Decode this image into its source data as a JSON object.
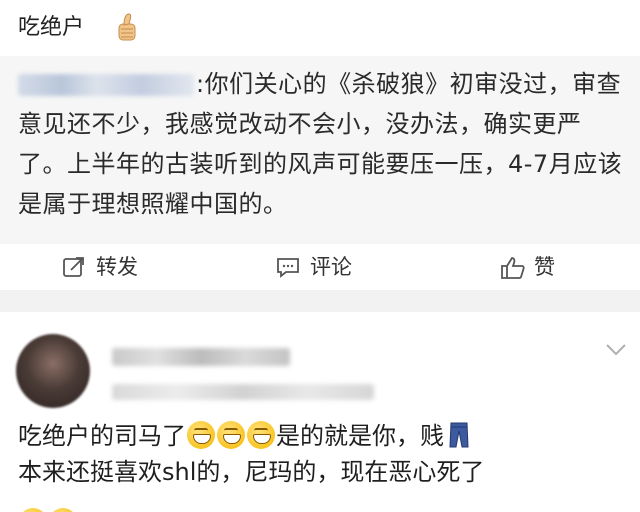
{
  "post": {
    "title": "吃绝户",
    "thumb_icon": "thumbs-up-icon"
  },
  "quote": {
    "text": ":你们关心的《杀破狼》初审没过，审查意见还不少，我感觉改动不会小，没办法，确实更严了。上半年的古装听到的风声可能要压一压，4-7月应该是属于理想照耀中国的。"
  },
  "actions": {
    "repost_label": "转发",
    "comment_label": "评论",
    "like_label": "赞",
    "repost_icon": "share-icon",
    "comment_icon": "comment-icon",
    "like_icon": "thumbs-up-icon"
  },
  "comment": {
    "line1_part1": "吃绝户的司马了",
    "line1_part2": "是的就是你，贱",
    "line2": "本来还挺喜欢shl的，尼玛的，现在恶心死了",
    "emoji_icon": "grinning-emoji-icon",
    "pants_icon": "jeans-emoji-icon",
    "menu_icon": "chevron-down-icon"
  },
  "colors": {
    "quote_bg": "#f6f6f6",
    "separator_bg": "#f2f2f2",
    "text": "#1f1f1f"
  }
}
